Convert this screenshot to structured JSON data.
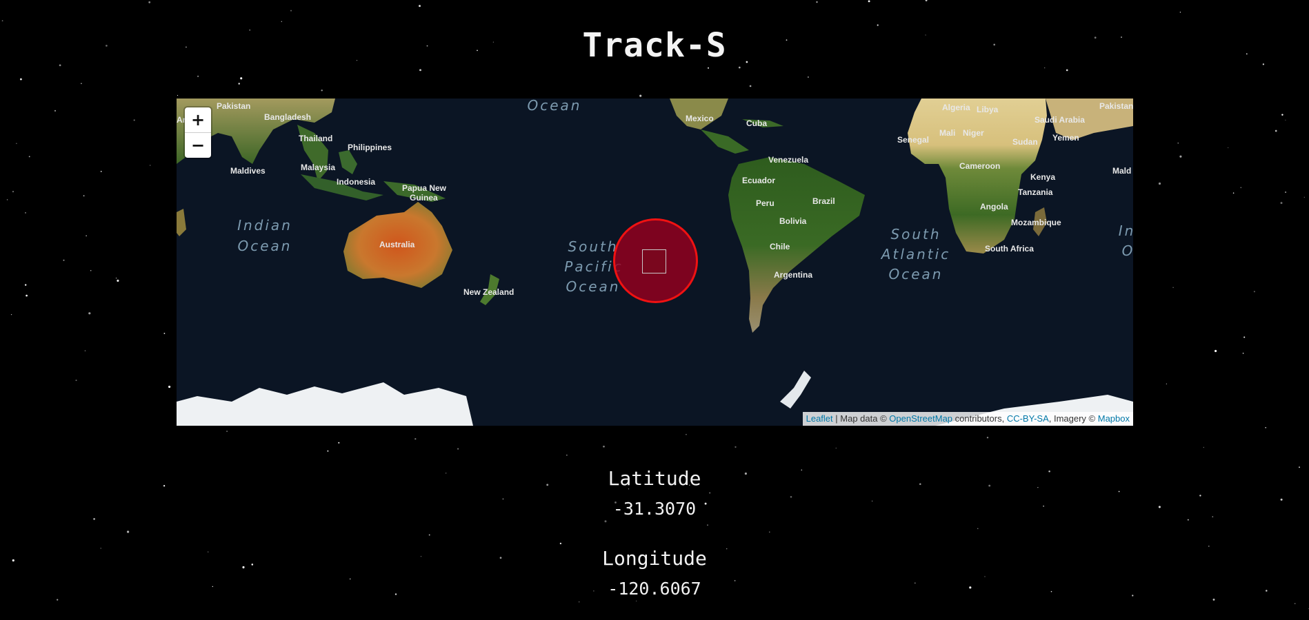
{
  "page": {
    "title": "Track-S"
  },
  "map": {
    "zoom_in_label": "+",
    "zoom_out_label": "−",
    "labels": {
      "ocean_top": "Ocean",
      "pakistan_left": "Pakistan",
      "ar_left": "Ar",
      "bangladesh": "Bangladesh",
      "thailand": "Thailand",
      "philippines": "Philippines",
      "maldives_left": "Maldives",
      "malaysia": "Malaysia",
      "indonesia": "Indonesia",
      "papua_new_guinea_1": "Papua New",
      "papua_new_guinea_2": "Guinea",
      "indian_ocean_1": "Indian",
      "indian_ocean_2": "Ocean",
      "australia": "Australia",
      "new_zealand": "New Zealand",
      "south_pacific_1": "South",
      "south_pacific_2": "Pacific",
      "south_pacific_3": "Ocean",
      "mexico": "Mexico",
      "cuba": "Cuba",
      "venezuela": "Venezuela",
      "ecuador": "Ecuador",
      "peru": "Peru",
      "brazil": "Brazil",
      "bolivia": "Bolivia",
      "chile": "Chile",
      "argentina": "Argentina",
      "south_atlantic_1": "South",
      "south_atlantic_2": "Atlantic",
      "south_atlantic_3": "Ocean",
      "algeria": "Algeria",
      "libya": "Libya",
      "pakistan_right": "Pakistan",
      "saudi_arabia": "Saudi Arabia",
      "mali": "Mali",
      "niger": "Niger",
      "senegal": "Senegal",
      "sudan": "Sudan",
      "yemen": "Yemen",
      "cameroon": "Cameroon",
      "kenya": "Kenya",
      "tanzania": "Tanzania",
      "angola": "Angola",
      "mozambique": "Mozambique",
      "south_africa": "South Africa",
      "maldives_right": "Mald",
      "indian_right_1": "In",
      "indian_right_2": "O"
    },
    "attribution": {
      "leaflet": "Leaflet",
      "sep": " | Map data © ",
      "osm": "OpenStreetMap",
      "contributors": " contributors, ",
      "license": "CC-BY-SA",
      "imagery": ", Imagery © ",
      "mapbox": "Mapbox"
    },
    "colors": {
      "marker_stroke": "#f01212",
      "marker_fill": "#96001e",
      "ocean": "#0b1524",
      "link": "#0078a8"
    },
    "marker": {
      "latitude": -31.307,
      "longitude": -120.6067
    }
  },
  "coords": {
    "latitude_label": "Latitude",
    "latitude_value": "-31.3070",
    "longitude_label": "Longitude",
    "longitude_value": "-120.6067"
  }
}
